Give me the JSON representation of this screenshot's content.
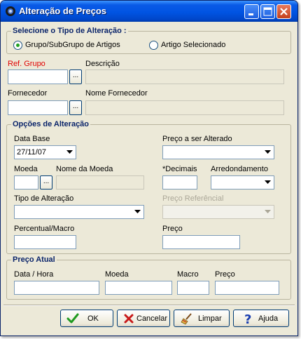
{
  "window": {
    "title": "Alteração de Preços"
  },
  "tipo_group": {
    "title": "Selecione o Tipo de Alteração :",
    "option_group": "Grupo/SubGrupo de Artigos",
    "option_artigo": "Artigo Selecionado",
    "selected": "option_group"
  },
  "ref_grupo": {
    "label": "Ref. Grupo",
    "value": "",
    "lookup_label": "..."
  },
  "descricao": {
    "label": "Descrição",
    "value": ""
  },
  "fornecedor": {
    "label": "Fornecedor",
    "value": "",
    "lookup_label": "..."
  },
  "nome_fornecedor": {
    "label": "Nome Fornecedor",
    "value": ""
  },
  "opcoes": {
    "title": "Opções de Alteração",
    "data_base": {
      "label": "Data Base",
      "value": "27/11/07"
    },
    "preco_alterado": {
      "label": "Preço a ser Alterado",
      "value": ""
    },
    "moeda": {
      "label": "Moeda",
      "value": "",
      "lookup_label": "..."
    },
    "nome_moeda": {
      "label": "Nome da Moeda",
      "value": ""
    },
    "decimais": {
      "label": "*Decimais",
      "value": ""
    },
    "arredondamento": {
      "label": "Arredondamento",
      "value": ""
    },
    "tipo_alteracao": {
      "label": "Tipo de Alteração",
      "value": ""
    },
    "preco_referencial": {
      "label": "Preço Referêncial",
      "value": ""
    },
    "percentual": {
      "label": "Percentual/Macro",
      "value": ""
    },
    "preco": {
      "label": "Preço",
      "value": ""
    }
  },
  "preco_atual": {
    "title": "Preço Atual",
    "data_hora": {
      "label": "Data / Hora",
      "value": ""
    },
    "moeda": {
      "label": "Moeda",
      "value": ""
    },
    "macro": {
      "label": "Macro",
      "value": ""
    },
    "preco": {
      "label": "Preço",
      "value": ""
    }
  },
  "buttons": {
    "ok": "OK",
    "cancelar": "Cancelar",
    "limpar": "Limpar",
    "ajuda": "Ajuda"
  },
  "colors": {
    "title_bar": "#0054e3",
    "accent_group_title": "#0a246a",
    "ref_label": "#e00000"
  },
  "icons": {
    "title": "app-icon",
    "ok": "checkmark-icon",
    "cancel": "x-icon",
    "clear": "broom-icon",
    "help": "question-icon"
  }
}
